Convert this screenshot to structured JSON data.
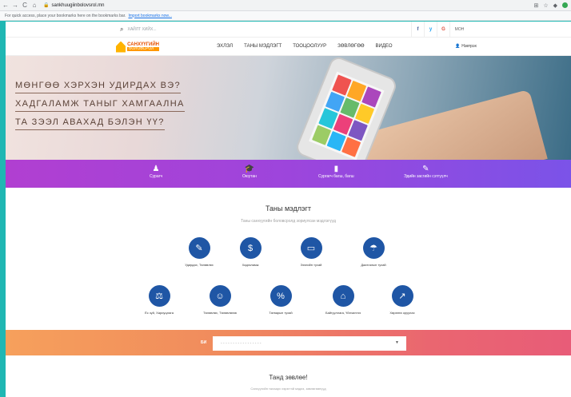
{
  "browser": {
    "url": "sankhuugiinbolovsrol.mn",
    "bookmarks_text": "For quick access, place your bookmarks here on the bookmarks bar.",
    "import_link": "Import bookmarks now..."
  },
  "top": {
    "search_placeholder": "ХАЙЛТ ХИЙХ...",
    "social": [
      "f",
      "y",
      "G"
    ],
    "lang": "МОН"
  },
  "logo": {
    "line1": "САНХҮҮГИЙН",
    "line2": "БОЛОВСРОЛ"
  },
  "nav": {
    "items": [
      "ЭХЛЭЛ",
      "ТАНЫ МЭДЛЭГТ",
      "ТООЦООЛУУР",
      "ЗӨВЛӨГӨӨ",
      "ВИДЕО"
    ],
    "login": "Нэвтрэх"
  },
  "hero": {
    "line1": "МӨНГӨӨ ХЭРХЭН УДИРДАХ ВЭ?",
    "line2": "ХАДГАЛАМЖ ТАНЫГ ХАМГААЛНА",
    "line3": "ТА ЗЭЭЛ АВАХАД БЭЛЭН ҮҮ?"
  },
  "audience": {
    "items": [
      {
        "label": "Сурагч",
        "icon": "person-icon"
      },
      {
        "label": "Оюутан",
        "icon": "graduation-cap-icon"
      },
      {
        "label": "Сургагч багш, багш",
        "icon": "book-icon"
      },
      {
        "label": "Эдийн засгийн сэтгүүлч",
        "icon": "pen-icon"
      }
    ]
  },
  "knowledge": {
    "title": "Таны мэдлэгт",
    "subtitle": "Таны санхүүгийн боловсролд зориулсан мэдлэгүүд",
    "row1": [
      {
        "label": "Удирдах, Төлөвлөх",
        "icon": "plan-icon"
      },
      {
        "label": "Хадгаламж",
        "icon": "savings-icon"
      },
      {
        "label": "Зээлийн тухай",
        "icon": "loan-icon"
      },
      {
        "label": "Даатгалын тухай",
        "icon": "umbrella-icon"
      }
    ],
    "row2": [
      {
        "label": "Ёс зүй, Хариуцлага",
        "icon": "scales-icon"
      },
      {
        "label": "Төлөвлөх, Төлөвлөгөө",
        "icon": "hands-icon"
      },
      {
        "label": "Татварын тухай",
        "icon": "tax-icon"
      },
      {
        "label": "Байгууллага, Үйлчилгээ",
        "icon": "bank-icon"
      },
      {
        "label": "Хөрөнгө оруулах",
        "icon": "invest-icon"
      }
    ]
  },
  "selector": {
    "label": "БИ",
    "placeholder": "- - - - - - - - - - - - - - - - -"
  },
  "advice": {
    "title": "Танд зөвлөе!",
    "subtitle": "Санхүүгийн талаарх хэрэгтэй мэдээ, зөвлөгөөнүүд"
  }
}
